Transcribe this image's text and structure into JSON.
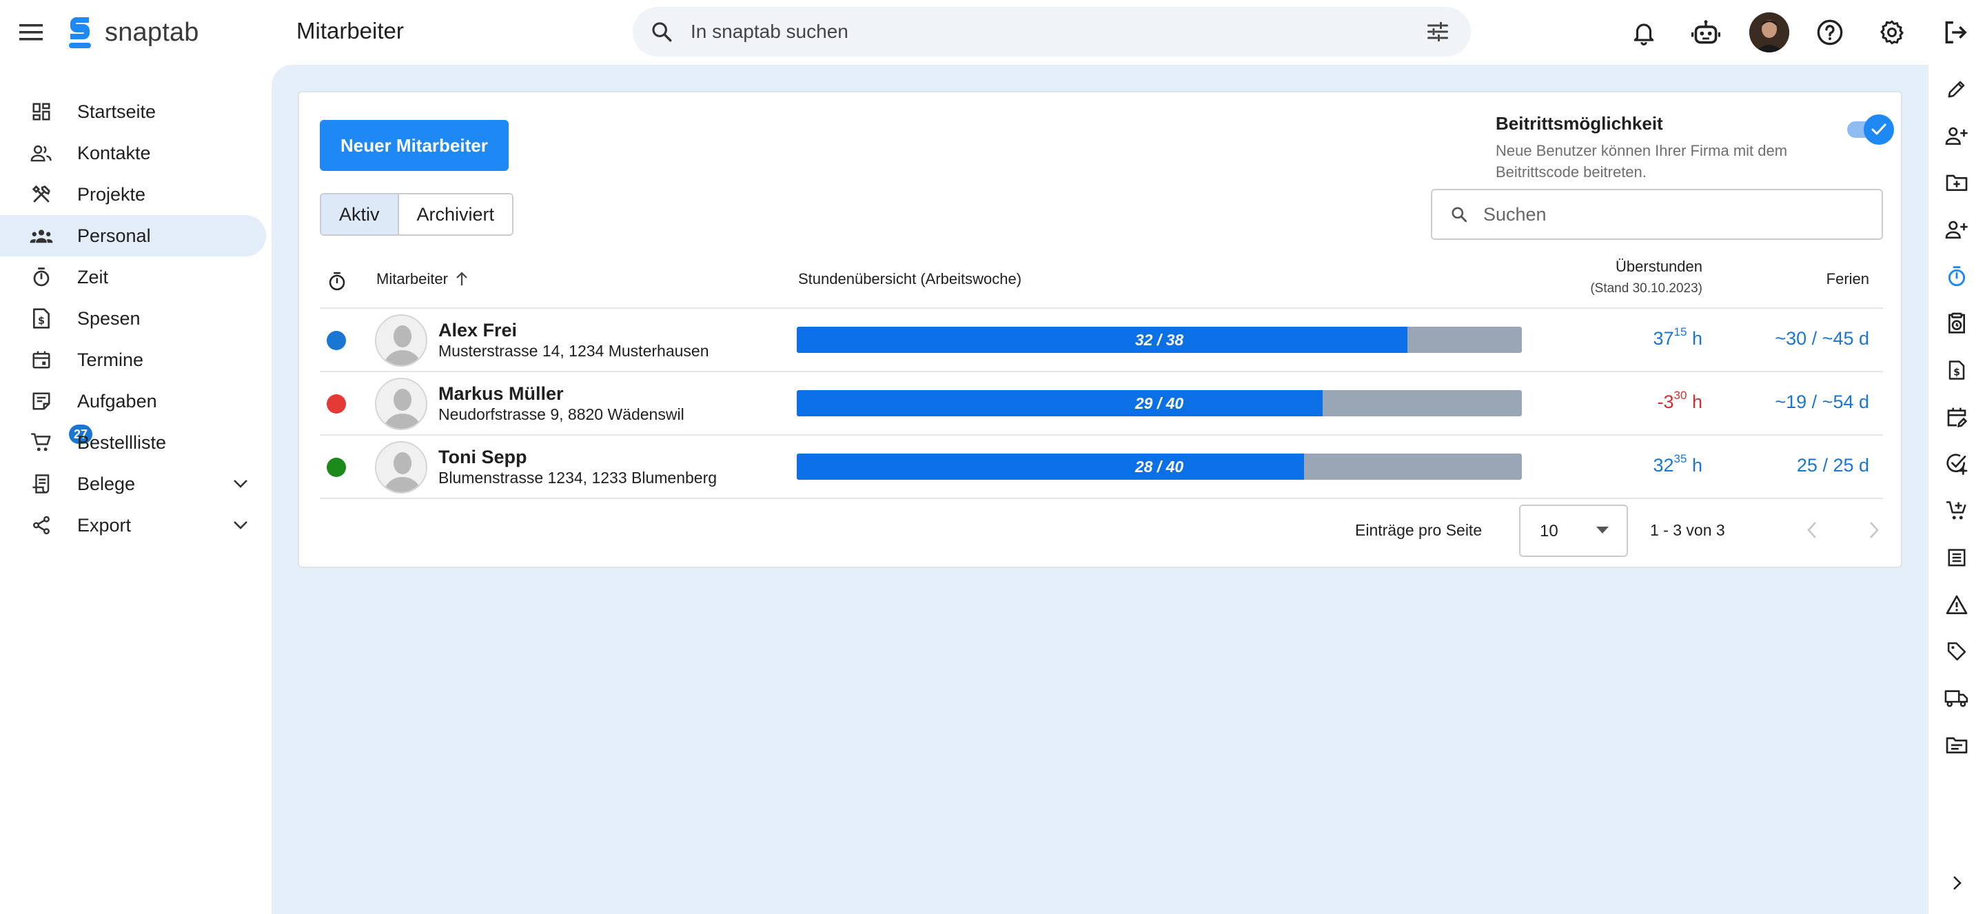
{
  "app": {
    "name": "snaptab",
    "page_title": "Mitarbeiter",
    "search_placeholder": "In snaptab suchen"
  },
  "colors": {
    "primary": "#1e88f5",
    "bar_fill": "#0b6fe6",
    "bar_track": "#98a6b6",
    "active_nav": "#e3edfa",
    "main_bg": "#e5eff9",
    "status_blue": "#1976d2",
    "status_red": "#e53935",
    "status_green": "#1b8a1b",
    "negative": "#d32f2f"
  },
  "sidebar": {
    "items": [
      {
        "label": "Startseite",
        "icon": "dashboard-icon"
      },
      {
        "label": "Kontakte",
        "icon": "contacts-icon"
      },
      {
        "label": "Projekte",
        "icon": "tools-icon"
      },
      {
        "label": "Personal",
        "icon": "groups-icon",
        "active": true
      },
      {
        "label": "Zeit",
        "icon": "timer-icon"
      },
      {
        "label": "Spesen",
        "icon": "receipt-dollar-icon"
      },
      {
        "label": "Termine",
        "icon": "calendar-icon"
      },
      {
        "label": "Aufgaben",
        "icon": "task-note-icon"
      },
      {
        "label": "Bestellliste",
        "icon": "cart-icon",
        "badge": "27"
      },
      {
        "label": "Belege",
        "icon": "receipt-icon",
        "expandable": true
      },
      {
        "label": "Export",
        "icon": "share-icon",
        "expandable": true
      }
    ]
  },
  "toolbar": {
    "new_button": "Neuer Mitarbeiter",
    "tabs": [
      "Aktiv",
      "Archiviert"
    ],
    "active_tab": "Aktiv",
    "search_placeholder": "Suchen"
  },
  "join": {
    "title": "Beitrittsmöglichkeit",
    "description": "Neue Benutzer können Ihrer Firma mit dem Beitrittscode beitreten.",
    "enabled": true
  },
  "table": {
    "headers": {
      "employee": "Mitarbeiter",
      "hours": "Stundenübersicht (Arbeitswoche)",
      "overtime": "Überstunden",
      "overtime_note": "(Stand 30.10.2023)",
      "vacation": "Ferien"
    },
    "rows": [
      {
        "status": "blue",
        "name": "Alex Frei",
        "address": "Musterstrasse 14, 1234 Musterhausen",
        "hours_label": "32 / 38",
        "hours_done": 32,
        "hours_target": 38,
        "overtime_main": "37",
        "overtime_sup": "15",
        "overtime_unit": " h",
        "overtime_negative": false,
        "vacation": "~30 / ~45 d"
      },
      {
        "status": "red",
        "name": "Markus Müller",
        "address": "Neudorfstrasse 9, 8820 Wädenswil",
        "hours_label": "29 / 40",
        "hours_done": 29,
        "hours_target": 40,
        "overtime_main": "-3",
        "overtime_sup": "30",
        "overtime_unit": " h",
        "overtime_negative": true,
        "vacation": "~19 / ~54 d"
      },
      {
        "status": "green",
        "name": "Toni Sepp",
        "address": "Blumenstrasse 1234, 1233 Blumenberg",
        "hours_label": "28 / 40",
        "hours_done": 28,
        "hours_target": 40,
        "overtime_main": "32",
        "overtime_sup": "35",
        "overtime_unit": " h",
        "overtime_negative": false,
        "vacation": "25 / 25 d"
      }
    ]
  },
  "pagination": {
    "label": "Einträge pro Seite",
    "per_page": "10",
    "range": "1 - 3 von 3"
  }
}
